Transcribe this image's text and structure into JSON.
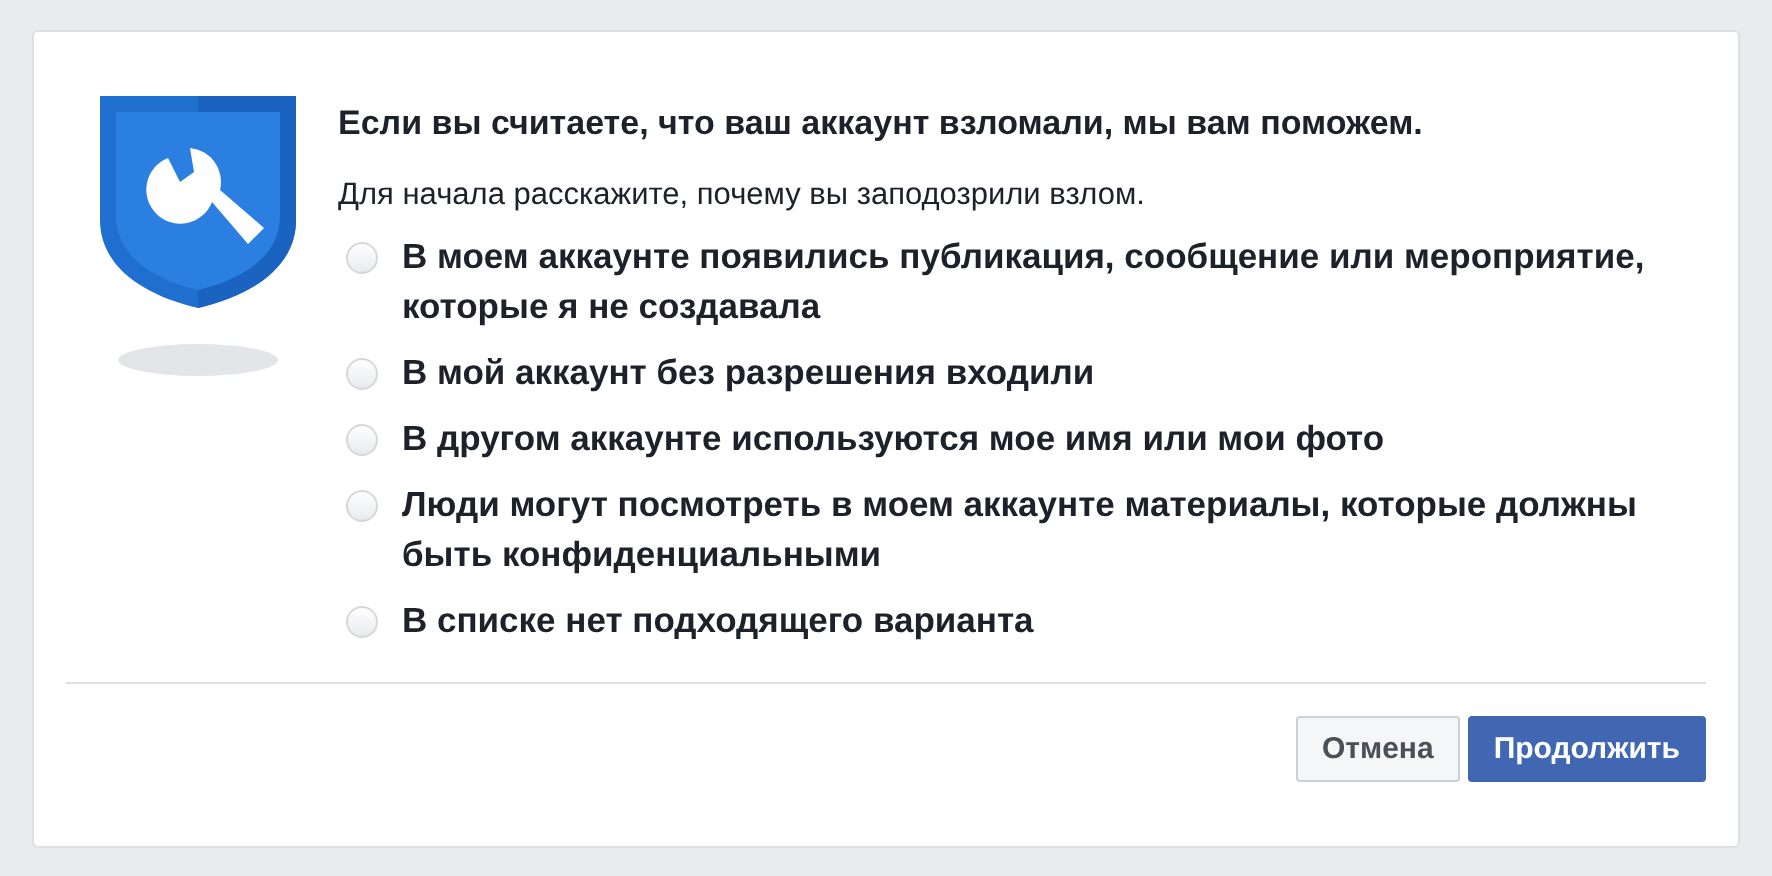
{
  "title": "Если вы считаете, что ваш аккаунт взломали, мы вам поможем.",
  "subtitle": "Для начала расскажите, почему вы заподозрили взлом.",
  "options": [
    {
      "label": "В моем аккаунте появились публикация, сообщение или мероприятие, которые я не создавала",
      "selected": false
    },
    {
      "label": "В мой аккаунт без разрешения входили",
      "selected": false
    },
    {
      "label": "В другом аккаунте используются мое имя или мои фото",
      "selected": false
    },
    {
      "label": "Люди могут посмотреть в моем аккаунте материалы, которые должны быть конфиденциальными",
      "selected": false
    },
    {
      "label": "В списке нет подходящего варианта",
      "selected": false
    }
  ],
  "buttons": [
    {
      "label": "Отмена",
      "kind": "secondary"
    },
    {
      "label": "Продолжить",
      "kind": "primary"
    }
  ]
}
